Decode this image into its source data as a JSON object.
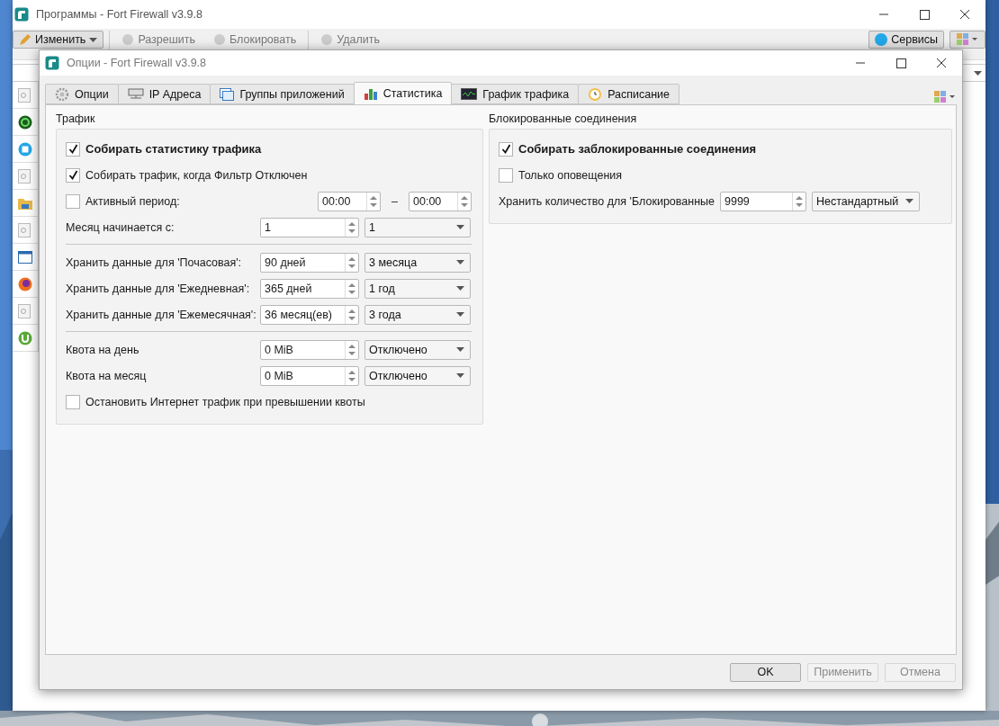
{
  "background_window": {
    "title": "Программы - Fort Firewall v3.9.8",
    "toolbar": [
      {
        "label": "Изменить",
        "disabled": false
      },
      {
        "label": "Разрешить",
        "disabled": true
      },
      {
        "label": "Блокировать",
        "disabled": true
      },
      {
        "label": "Удалить",
        "disabled": true
      }
    ],
    "services": "Сервисы"
  },
  "dialog": {
    "title": "Опции - Fort Firewall v3.9.8",
    "tabs": [
      {
        "label": "Опции",
        "selected": false
      },
      {
        "label": "IP Адреса",
        "selected": false
      },
      {
        "label": "Группы приложений",
        "selected": false
      },
      {
        "label": "Статистика",
        "selected": true
      },
      {
        "label": "График трафика",
        "selected": false
      },
      {
        "label": "Расписание",
        "selected": false
      }
    ],
    "traffic": {
      "title": "Трафик",
      "items": [
        {
          "kind": "checkbox",
          "label": "Собирать статистику трафика",
          "checked": true,
          "bold": true
        },
        {
          "kind": "checkbox",
          "label": "Собирать трафик, когда Фильтр Отключен",
          "checked": true,
          "bold": false
        },
        {
          "kind": "period",
          "label": "Активный период:",
          "checked": false,
          "from": "00:00",
          "dash": "–",
          "to": "00:00"
        },
        {
          "kind": "setting",
          "label": "Месяц начинается с:",
          "value": "1",
          "option": "1"
        },
        {
          "kind": "separator"
        },
        {
          "kind": "setting",
          "label": "Хранить данные для 'Почасовая':",
          "value": "90 дней",
          "option": "3 месяца"
        },
        {
          "kind": "setting",
          "label": "Хранить данные для 'Ежедневная':",
          "value": "365 дней",
          "option": "1 год"
        },
        {
          "kind": "setting",
          "label": "Хранить данные для 'Ежемесячная':",
          "value": "36 месяц(ев)",
          "option": "3 года"
        },
        {
          "kind": "separator"
        },
        {
          "kind": "setting",
          "label": "Квота на день",
          "value": "0 MiB",
          "option": "Отключено"
        },
        {
          "kind": "setting",
          "label": "Квота на месяц",
          "value": "0 MiB",
          "option": "Отключено"
        },
        {
          "kind": "checkbox",
          "label": "Остановить Интернет трафик при превышении квоты",
          "checked": false,
          "bold": false
        }
      ]
    },
    "blocked": {
      "title": "Блокированные соединения",
      "items": [
        {
          "kind": "checkbox",
          "label": "Собирать заблокированные соединения",
          "checked": true,
          "bold": true
        },
        {
          "kind": "checkbox",
          "label": "Только оповещения",
          "checked": false,
          "bold": false
        },
        {
          "kind": "setting",
          "label": "Хранить количество для 'Блокированные",
          "value": "9999",
          "option": "Нестандартный"
        }
      ]
    },
    "buttons": [
      {
        "label": "OK",
        "disabled": false
      },
      {
        "label": "Применить",
        "disabled": true
      },
      {
        "label": "Отмена",
        "disabled": true
      }
    ]
  }
}
